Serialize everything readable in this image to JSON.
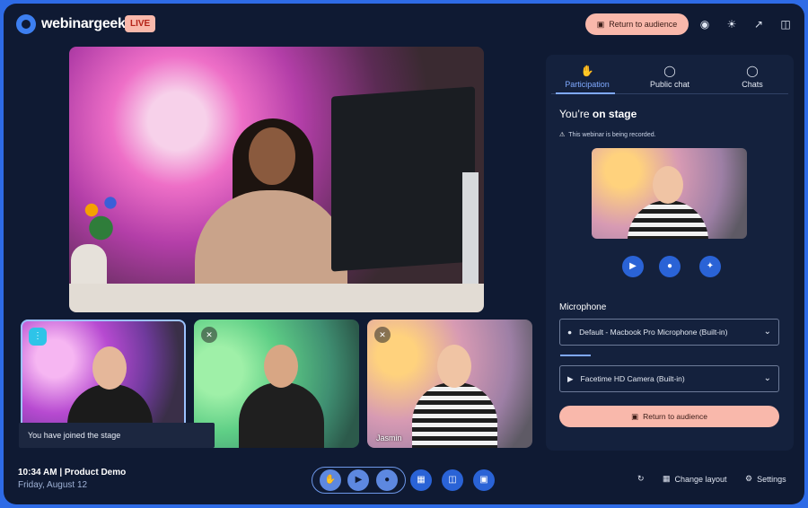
{
  "app": {
    "brand": "webinargeek",
    "live_badge": "LIVE"
  },
  "topbar": {
    "return_label": "Return to audience"
  },
  "toast": "You have joined the stage",
  "tiles": [
    {
      "name": ""
    },
    {
      "name": ""
    },
    {
      "name": "Jasmin"
    }
  ],
  "footer": {
    "time": "10:34 AM | Product Demo",
    "date": "Friday, August 12",
    "change_layout": "Change layout",
    "settings": "Settings"
  },
  "panel": {
    "tabs": [
      {
        "label": "Participation",
        "icon": "raised-hand-icon"
      },
      {
        "label": "Public chat",
        "icon": "chat-bubble-icon"
      },
      {
        "label": "Chats",
        "icon": "chat-bubble-icon"
      }
    ],
    "title_prefix": "You’re ",
    "title_emph": "on stage",
    "recording_note": "This webinar is being recorded.",
    "microphone_label": "Microphone",
    "mic_select": "Default - Macbook Pro Microphone (Built-in)",
    "camera_select": "Facetime HD Camera (Built-in)",
    "return_label": "Return to audience"
  },
  "colors": {
    "accent": "#2a63d6",
    "return_btn": "#f9b8ab",
    "background": "#0f1a33"
  }
}
